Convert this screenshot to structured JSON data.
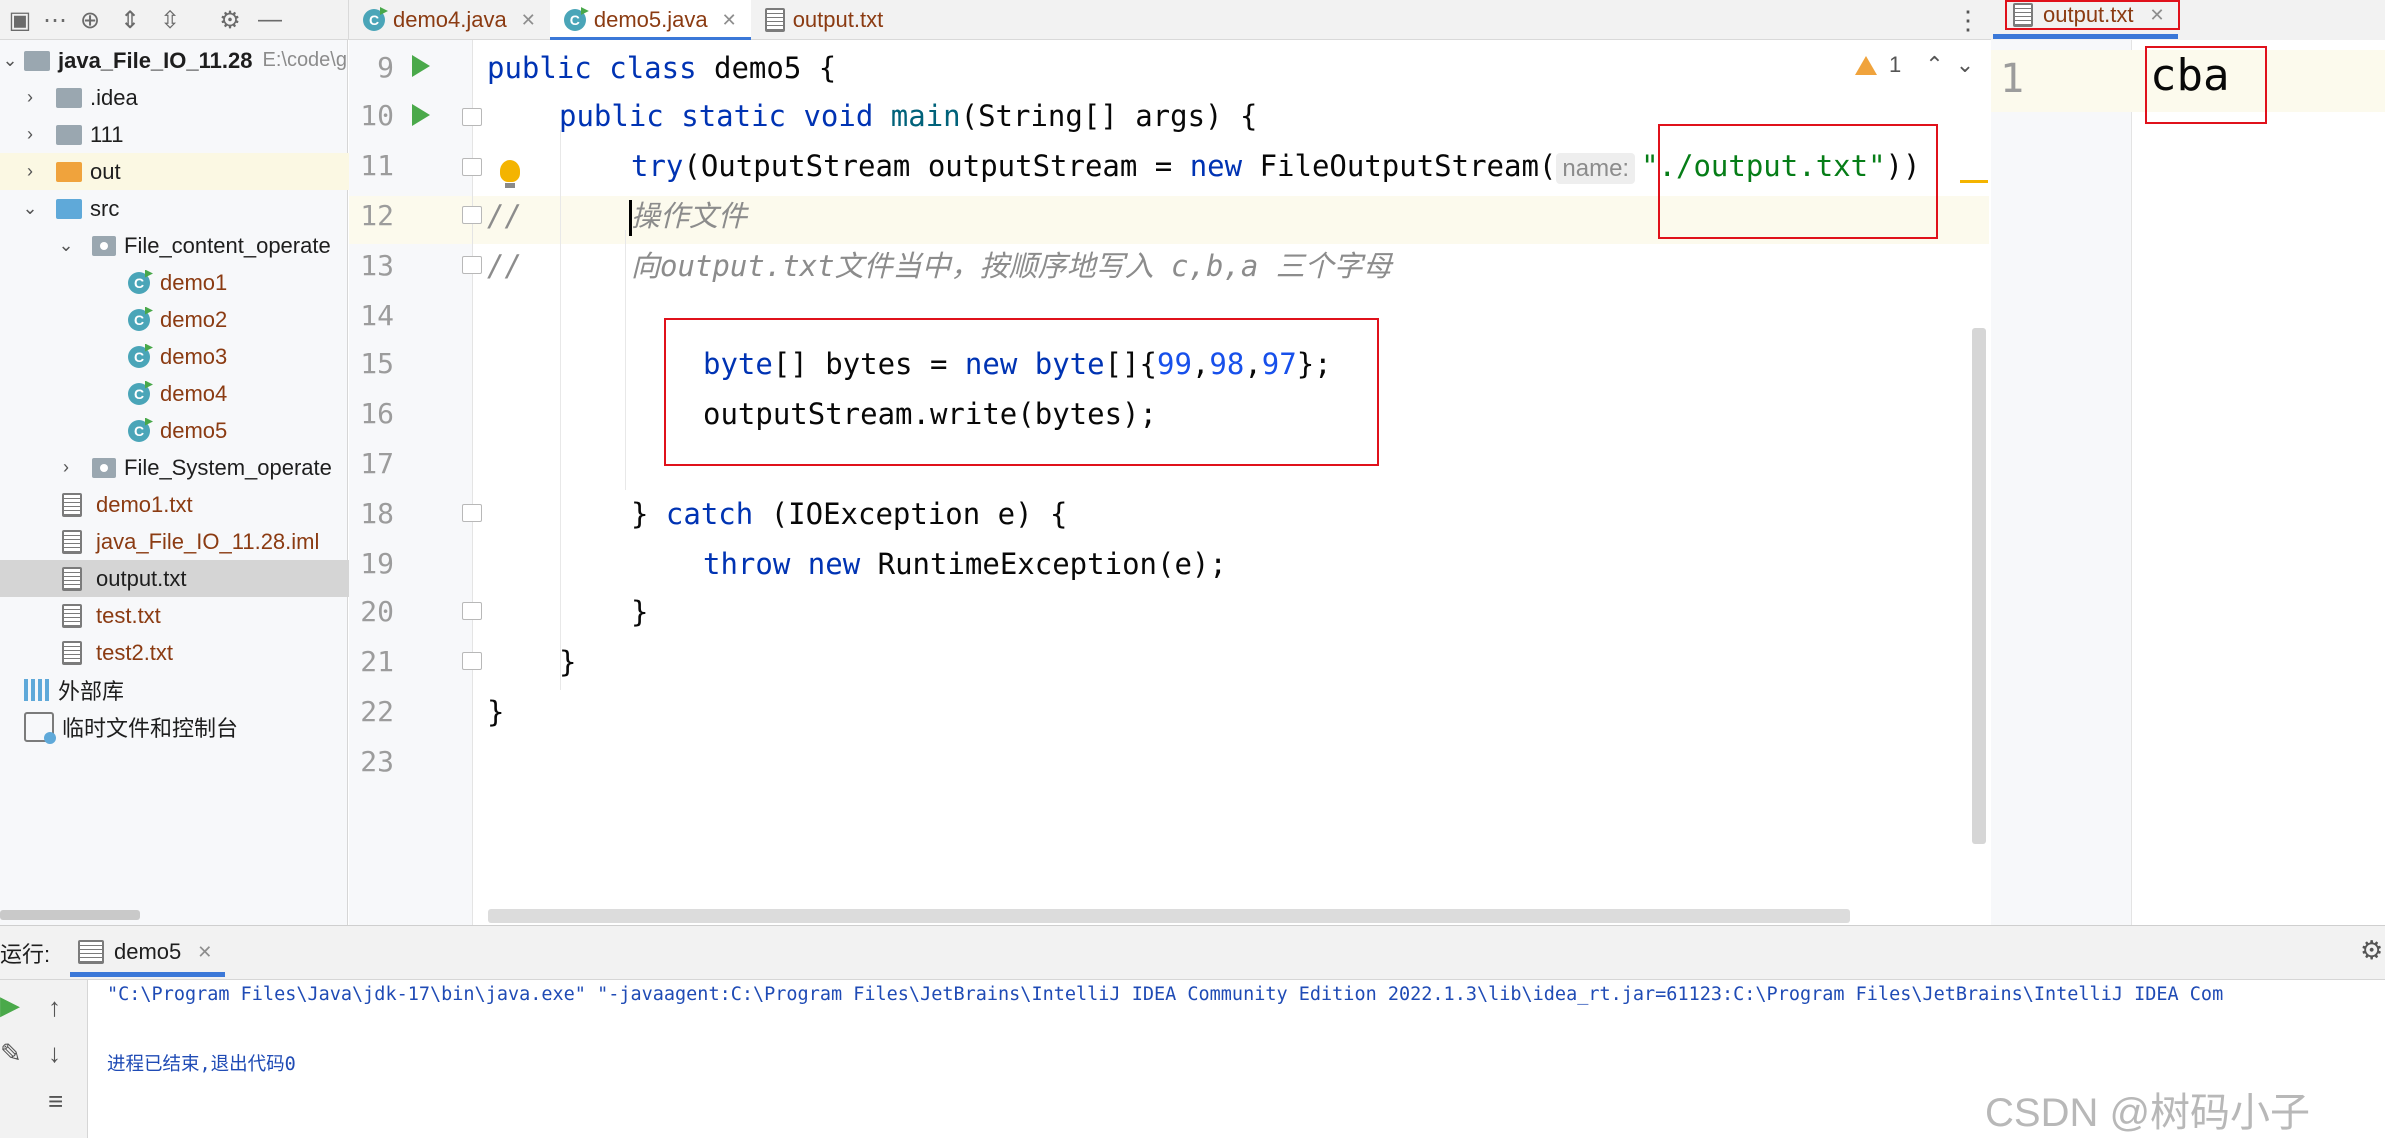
{
  "project_tree": {
    "root": {
      "label": "java_File_IO_11.28",
      "path_hint": "E:\\code\\g"
    },
    "items": [
      {
        "label": ".idea"
      },
      {
        "label": "111"
      },
      {
        "label": "out"
      },
      {
        "label": "src"
      },
      {
        "label": "File_content_operate"
      },
      {
        "label": "demo1"
      },
      {
        "label": "demo2"
      },
      {
        "label": "demo3"
      },
      {
        "label": "demo4"
      },
      {
        "label": "demo5"
      },
      {
        "label": "File_System_operate"
      },
      {
        "label": "demo1.txt"
      },
      {
        "label": "java_File_IO_11.28.iml"
      },
      {
        "label": "output.txt"
      },
      {
        "label": "test.txt"
      },
      {
        "label": "test2.txt"
      },
      {
        "label": "外部库"
      },
      {
        "label": "临时文件和控制台"
      }
    ]
  },
  "editor_tabs": [
    {
      "label": "demo4.java"
    },
    {
      "label": "demo5.java",
      "active": true
    },
    {
      "label": "output.txt"
    }
  ],
  "right_tab": {
    "label": "output.txt"
  },
  "inspections": {
    "warning_count": "1"
  },
  "code": {
    "line_numbers": [
      "9",
      "10",
      "11",
      "12",
      "13",
      "14",
      "15",
      "16",
      "17",
      "18",
      "19",
      "20",
      "21",
      "22",
      "23"
    ],
    "l9": {
      "kw1": "public",
      "kw2": "class",
      "name": " demo5 {"
    },
    "l10": {
      "kw1": "public",
      "kw2": "static",
      "kw3": "void",
      "fn": "main",
      "rest": "(String[] args) {"
    },
    "l11": {
      "kw1": "try",
      "mid": "(OutputStream outputStream = ",
      "kw2": "new",
      "rest": " FileOutputStream(",
      "hint": "name:",
      "str": "\"./output.txt\"",
      "end": "))"
    },
    "l12": {
      "cmt_prefix": "//",
      "cmt": "操作文件"
    },
    "l13": {
      "cmt_prefix": "//",
      "cmt": "向output.txt文件当中，按顺序地写入 c,b,a 三个字母"
    },
    "l15": {
      "kw1": "byte",
      "mid": "[] bytes = ",
      "kw2": "new",
      "kw3": "byte",
      "open": "[]{",
      "n1": "99",
      "n2": "98",
      "n3": "97",
      "comma": ",",
      "close": "};"
    },
    "l16": {
      "text": "outputStream.write(bytes);"
    },
    "l18": {
      "brace": "} ",
      "kw": "catch",
      "rest": " (IOException e) {"
    },
    "l19": {
      "kw1": "throw",
      "kw2": "new",
      "rest": " RuntimeException(e);"
    },
    "l20": {
      "text": "}"
    },
    "l21": {
      "text": "}"
    },
    "l22": {
      "text": "}"
    }
  },
  "output_file": {
    "line": "1",
    "content": "cba"
  },
  "run_panel": {
    "label": "运行:",
    "tab": "demo5",
    "console": [
      "\"C:\\Program Files\\Java\\jdk-17\\bin\\java.exe\" \"-javaagent:C:\\Program Files\\JetBrains\\IntelliJ IDEA Community Edition 2022.1.3\\lib\\idea_rt.jar=61123:C:\\Program Files\\JetBrains\\IntelliJ IDEA Com",
      "进程已结束,退出代码0"
    ]
  },
  "watermark": "CSDN @树码小子",
  "colors": {
    "accent": "#3b78d8",
    "annotation_red": "#e0111b",
    "run_green": "#4aa94a"
  }
}
